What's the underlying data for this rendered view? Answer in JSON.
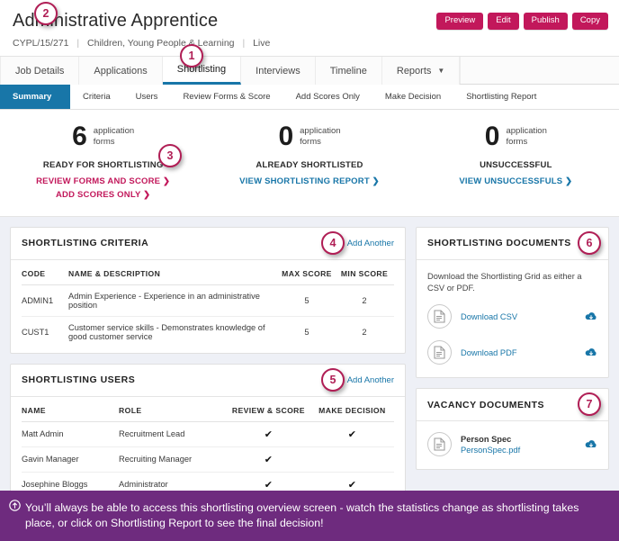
{
  "header": {
    "title": "Administrative Apprentice",
    "ref": "CYPL/15/271",
    "department": "Children, Young People & Learning",
    "status": "Live",
    "actions": [
      {
        "label": "Preview"
      },
      {
        "label": "Edit"
      },
      {
        "label": "Publish"
      },
      {
        "label": "Copy"
      }
    ]
  },
  "tabs": [
    {
      "label": "Job Details",
      "active": false
    },
    {
      "label": "Applications",
      "active": false
    },
    {
      "label": "Shortlisting",
      "active": true
    },
    {
      "label": "Interviews",
      "active": false
    },
    {
      "label": "Timeline",
      "active": false
    },
    {
      "label": "Reports",
      "active": false,
      "caret": "▼"
    }
  ],
  "subtabs": [
    {
      "label": "Summary",
      "active": true
    },
    {
      "label": "Criteria",
      "active": false
    },
    {
      "label": "Users",
      "active": false
    },
    {
      "label": "Review Forms & Score",
      "active": false
    },
    {
      "label": "Add Scores Only",
      "active": false
    },
    {
      "label": "Make Decision",
      "active": false
    },
    {
      "label": "Shortlisting Report",
      "active": false
    }
  ],
  "stats": [
    {
      "number": "6",
      "unit_line1": "application",
      "unit_line2": "forms",
      "label": "READY FOR SHORTLISTING",
      "links": [
        {
          "text": "REVIEW FORMS AND SCORE ❯",
          "color": "pink"
        },
        {
          "text": "ADD SCORES ONLY ❯",
          "color": "pink"
        }
      ]
    },
    {
      "number": "0",
      "unit_line1": "application",
      "unit_line2": "forms",
      "label": "ALREADY SHORTLISTED",
      "links": [
        {
          "text": "VIEW SHORTLISTING REPORT ❯",
          "color": "blue"
        }
      ]
    },
    {
      "number": "0",
      "unit_line1": "application",
      "unit_line2": "forms",
      "label": "UNSUCCESSFUL",
      "links": [
        {
          "text": "VIEW UNSUCCESSFULS ❯",
          "color": "blue"
        }
      ]
    }
  ],
  "criteria_panel": {
    "title": "SHORTLISTING CRITERIA",
    "add_label": "Add Another",
    "columns": [
      "CODE",
      "NAME & DESCRIPTION",
      "MAX SCORE",
      "MIN SCORE"
    ],
    "rows": [
      {
        "code": "ADMIN1",
        "name": "Admin Experience - Experience in an administrative position",
        "max": "5",
        "min": "2"
      },
      {
        "code": "CUST1",
        "name": "Customer service skills - Demonstrates knowledge of good customer service",
        "max": "5",
        "min": "2"
      }
    ]
  },
  "users_panel": {
    "title": "SHORTLISTING USERS",
    "add_label": "Add Another",
    "columns": [
      "NAME",
      "ROLE",
      "REVIEW & SCORE",
      "MAKE DECISION"
    ],
    "rows": [
      {
        "name": "Matt Admin",
        "role": "Recruitment Lead",
        "review": "✔",
        "decision": "✔"
      },
      {
        "name": "Gavin Manager",
        "role": "Recruiting Manager",
        "review": "✔",
        "decision": ""
      },
      {
        "name": "Josephine Bloggs",
        "role": "Administrator",
        "review": "✔",
        "decision": "✔"
      }
    ]
  },
  "shortlisting_documents": {
    "title": "SHORTLISTING DOCUMENTS",
    "intro": "Download the Shortlisting Grid as either a CSV or PDF.",
    "items": [
      {
        "link": "Download CSV"
      },
      {
        "link": "Download PDF"
      }
    ]
  },
  "vacancy_documents": {
    "title": "VACANCY DOCUMENTS",
    "items": [
      {
        "name": "Person Spec",
        "file": "PersonSpec.pdf"
      }
    ]
  },
  "badges": {
    "b1": "1",
    "b2": "2",
    "b3": "3",
    "b4": "4",
    "b5": "5",
    "b6": "6",
    "b7": "7"
  },
  "footer": {
    "text": "You’ll always be able to access this shortlisting overview screen - watch the statistics change as shortlisting takes place, or click on Shortlisting Report to see the final decision!"
  },
  "colors": {
    "accent_pink": "#c2185b",
    "accent_blue": "#1876a8",
    "footer_purple": "#6e2b7e",
    "badge_ring": "#b01e55"
  }
}
